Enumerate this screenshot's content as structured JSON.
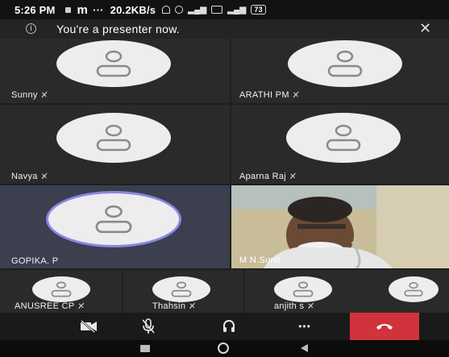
{
  "status_bar": {
    "time": "5:26 PM",
    "carrier_glyph": "m",
    "more": "···",
    "network_speed": "20.2KB/s",
    "battery": "73"
  },
  "banner": {
    "message": "You're a presenter now.",
    "info_glyph": "i",
    "close_glyph": "✕"
  },
  "participants": [
    {
      "name": "Sunny",
      "muted": true
    },
    {
      "name": "ARATHI PM",
      "muted": true
    },
    {
      "name": "Navya",
      "muted": true
    },
    {
      "name": "Aparna Raj",
      "muted": true
    },
    {
      "name": "GOPIKA. P",
      "muted": false,
      "active_speaker": true
    },
    {
      "name": "M N.Sunil",
      "muted": false,
      "video_on": true
    },
    {
      "name": "ANUSREE CP",
      "muted": true
    },
    {
      "name": "Thahsin",
      "muted": true
    },
    {
      "name": "anjith s",
      "muted": true
    },
    {
      "name": "",
      "muted": false
    }
  ],
  "controls": {
    "camera_icon": "video-off-icon",
    "mic_icon": "mic-off-icon",
    "audio_icon": "headset-icon",
    "more_label": "•••",
    "end_call_icon": "phone-hangup-icon"
  },
  "colors": {
    "tile_bg": "#2a2a2a",
    "active_tile_bg": "#3b3f4e",
    "active_ring": "#8a85e6",
    "end_call": "#d2323b"
  }
}
